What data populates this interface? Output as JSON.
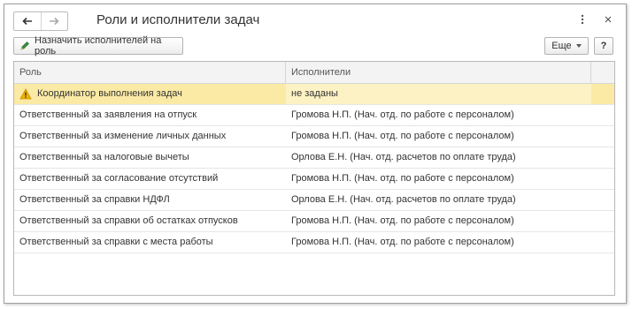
{
  "window": {
    "title": "Роли и исполнители задач",
    "nav": {
      "back_icon": "arrow-left-icon",
      "forward_icon": "arrow-right-icon"
    },
    "more_icon": "vertical-dots-icon",
    "close_icon": "close-icon"
  },
  "toolbar": {
    "assign_label": "Назначить исполнителей на роль",
    "assign_icon": "pencil-icon",
    "more_label": "Еще",
    "help_label": "?"
  },
  "table": {
    "columns": [
      "Роль",
      "Исполнители"
    ],
    "rows": [
      {
        "role": "Координатор выполнения задач",
        "performers": "не заданы",
        "warning": true
      },
      {
        "role": "Ответственный за заявления на отпуск",
        "performers": "Громова Н.П. (Нач. отд. по работе с персоналом)"
      },
      {
        "role": "Ответственный за изменение личных данных",
        "performers": "Громова Н.П. (Нач. отд. по работе с персоналом)"
      },
      {
        "role": "Ответственный за налоговые вычеты",
        "performers": "Орлова Е.Н. (Нач. отд. расчетов по оплате труда)"
      },
      {
        "role": "Ответственный за согласование отсутствий",
        "performers": "Громова Н.П. (Нач. отд. по работе с персоналом)"
      },
      {
        "role": "Ответственный за справки НДФЛ",
        "performers": "Орлова Е.Н. (Нач. отд. расчетов по оплате труда)"
      },
      {
        "role": "Ответственный за справки об остатках отпусков",
        "performers": "Громова Н.П. (Нач. отд. по работе с персоналом)"
      },
      {
        "role": "Ответственный за справки с места работы",
        "performers": "Громова Н.П. (Нач. отд. по работе с персоналом)"
      }
    ]
  },
  "colors": {
    "selected_row": "#fbeaa5",
    "warning": "#f0b400"
  }
}
